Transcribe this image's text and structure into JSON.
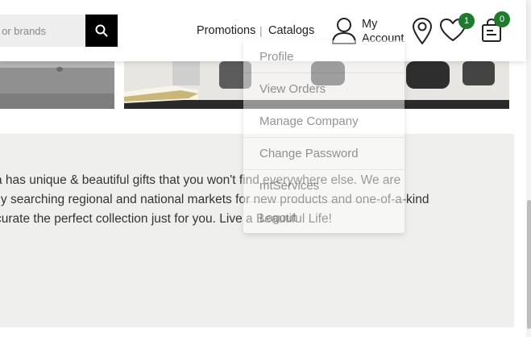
{
  "header": {
    "search": {
      "placeholder": "s or brands"
    },
    "nav": {
      "promotions": "Promotions",
      "separator": "|",
      "catalogs": "Catalogs"
    },
    "account": {
      "line1": "My",
      "line2": "Account"
    },
    "wishlist_count": "1",
    "cart_count": "0",
    "icons": [
      "search-icon",
      "user-icon",
      "location-pin-icon",
      "heart-icon",
      "shopping-bag-icon"
    ],
    "accent_color": "#1e7a2e"
  },
  "account_menu": {
    "items": [
      "Profile",
      "View Orders",
      "Manage Company",
      "Change Password",
      "mtServices",
      "Logout"
    ]
  },
  "about": {
    "lines": [
      "a has unique & beautiful gifts that you won't find everywhere else. We are",
      "lly searching regional and national markets for new products and one-of-a-kind",
      "curate the perfect collection just for you. Live a Beautiful Life!"
    ]
  }
}
